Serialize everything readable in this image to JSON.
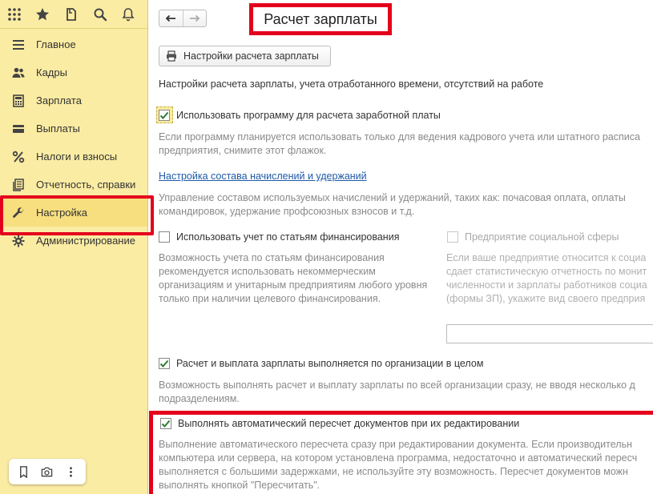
{
  "topbar": {
    "icons": [
      "apps-grid-icon",
      "star-icon",
      "history-icon",
      "search-icon",
      "bell-icon"
    ]
  },
  "sidebar": {
    "items": [
      {
        "label": "Главное",
        "icon": "menu-lines-icon"
      },
      {
        "label": "Кадры",
        "icon": "people-icon"
      },
      {
        "label": "Зарплата",
        "icon": "calculator-icon"
      },
      {
        "label": "Выплаты",
        "icon": "wallet-icon"
      },
      {
        "label": "Налоги и взносы",
        "icon": "percent-icon"
      },
      {
        "label": "Отчетность, справки",
        "icon": "reports-icon"
      },
      {
        "label": "Настройка",
        "icon": "wrench-icon"
      },
      {
        "label": "Администрирование",
        "icon": "gear-icon"
      }
    ],
    "active_index": 6,
    "bottom_tools": [
      "bookmark-icon",
      "camera-icon",
      "more-vertical-icon"
    ]
  },
  "header": {
    "title": "Расчет зарплаты"
  },
  "main": {
    "settings_button": "Настройки расчета зарплаты",
    "intro": "Настройки расчета зарплаты, учета отработанного времени, отсутствий на работе",
    "use_program": {
      "label": "Использовать программу для расчета заработной платы",
      "checked": true,
      "hint1": "Если программу планируется использовать только для ведения кадрового учета или штатного расписа",
      "hint2": "предприятия, снимите этот флажок."
    },
    "accruals_link": "Настройка состава начислений и удержаний",
    "accruals_hint1": "Управление составом используемых начислений и удержаний, таких как: почасовая оплата, оплаты",
    "accruals_hint2": "командировок, удержание профсоюзных взносов и т.д.",
    "financing": {
      "label": "Использовать учет по статьям финансирования",
      "checked": false,
      "hint": [
        "Возможность учета по статьям финансирования",
        "рекомендуется использовать некоммерческим",
        "организациям и унитарным предприятиям любого уровня",
        "только при наличии целевого финансирования."
      ]
    },
    "social": {
      "label": "Предприятие социальной сферы",
      "checked": false,
      "disabled": true,
      "hint": [
        "Если ваше предприятие относится к социа",
        "сдает статистическую отчетность по монит",
        "численности и зарплаты работников социа",
        "(формы ЗП), укажите вид своего предприя"
      ],
      "input_value": ""
    },
    "org_whole": {
      "label": "Расчет и выплата зарплаты выполняется по организации в целом",
      "checked": true,
      "hint1": "Возможность выполнять расчет и выплату зарплаты по всей организации сразу, не вводя несколько д",
      "hint2": "подразделениям."
    },
    "auto_recalc": {
      "label": "Выполнять автоматический пересчет документов при их редактировании",
      "checked": true,
      "hint": [
        "Выполнение автоматического пересчета сразу при редактировании документа. Если производительн",
        "компьютера или сервера, на котором установлена программа, недостаточно и автоматический пересч",
        "выполняется с большими задержками, не используйте эту возможность. Пересчет документов можн",
        "выполнять кнопкой \"Пересчитать\"."
      ]
    }
  },
  "colors": {
    "sidebar_bg": "#fbeca3",
    "highlight": "#e4001c",
    "check": "#2e7d32",
    "link": "#1f5aa8"
  }
}
